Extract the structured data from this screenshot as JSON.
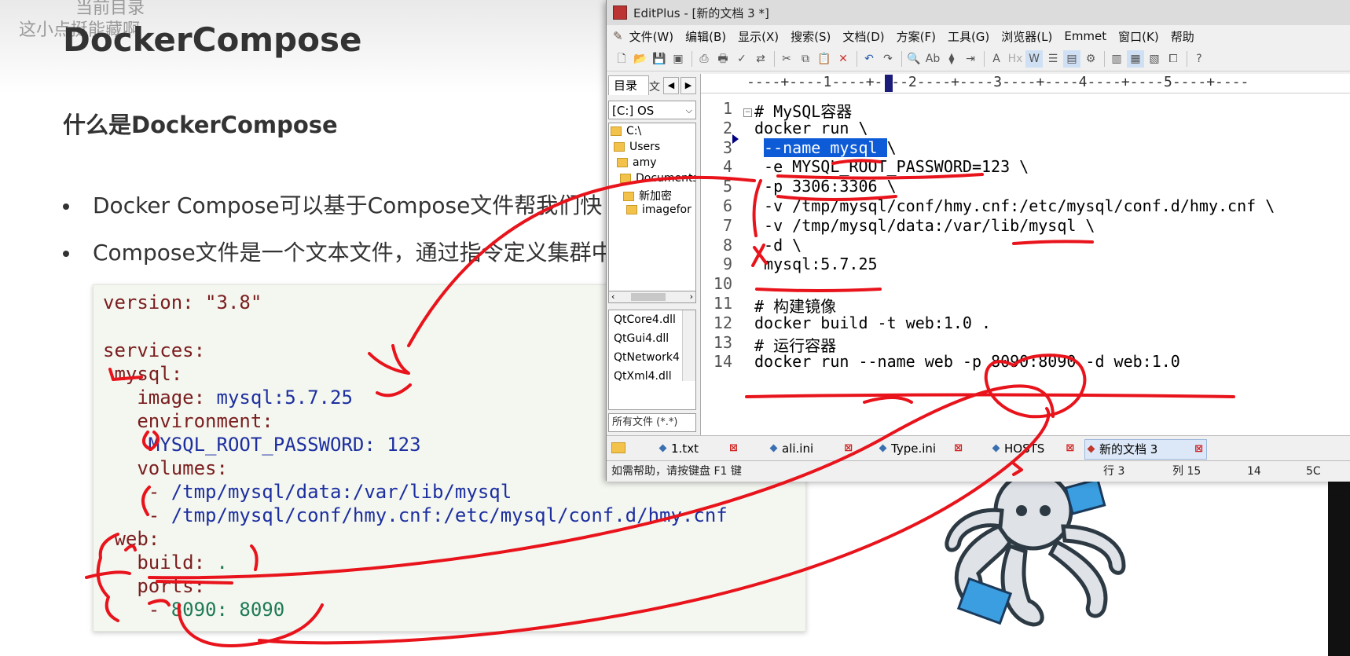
{
  "slide": {
    "overlay_top": "当前目录",
    "overlay_sub": "这小点挺能藏啊",
    "title": "DockerCompose",
    "subtitle": "什么是DockerCompose",
    "bullets": [
      "Docker Compose可以基于Compose文件帮我们快",
      "Compose文件是一个文本文件，通过指令定义集群中"
    ],
    "yaml": {
      "l1": "version: \"3.8\"",
      "l3": "services:",
      "l4": " mysql:",
      "l5_key": "   image: ",
      "l5_val": "mysql:5.7.25",
      "l6": "   environment:",
      "l7_key": "    MYSQL_ROOT_PASSWORD: ",
      "l7_val": "123",
      "l8": "   volumes:",
      "l9_dash": "    - ",
      "l9_val": "/tmp/mysql/data:/var/lib/mysql",
      "l10_dash": "    - ",
      "l10_val": "/tmp/mysql/conf/hmy.cnf:/etc/mysql/conf.d/hmy.cnf",
      "l11": " web:",
      "l12_key": "   build: ",
      "l12_val": ".",
      "l13": "   ports:",
      "l14_dash": "    - ",
      "l14_val": "8090: 8090"
    }
  },
  "window": {
    "title": "EditPlus - [新的文档 3 *]",
    "menu": [
      "文件(W)",
      "编辑(B)",
      "显示(X)",
      "搜索(S)",
      "文档(D)",
      "方案(F)",
      "工具(G)",
      "浏览器(L)",
      "Emmet",
      "窗口(K)",
      "帮助"
    ],
    "left_panel": {
      "tab_dir": "目录",
      "tab_other": "文",
      "drive": "[C:] OS",
      "tree": [
        "C:\\",
        "Users",
        "amy",
        "Documents",
        "新加密",
        "imagefor"
      ],
      "files": [
        "QtCore4.dll",
        "QtGui4.dll",
        "QtNetwork4",
        "QtXml4.dll"
      ],
      "filter": "所有文件 (*.*)"
    },
    "ruler": "----+----1----+----2----+----3----+----4----+----5----+----",
    "lines": [
      {
        "n": "1",
        "text": "# MySQL容器"
      },
      {
        "n": "2",
        "text": "docker run \\"
      },
      {
        "n": "3",
        "selected": "--name mysql ",
        "rest": "\\"
      },
      {
        "n": "4",
        "text": " -e MYSQL_ROOT_PASSWORD=123 \\"
      },
      {
        "n": "5",
        "text": " -p 3306:3306 \\"
      },
      {
        "n": "6",
        "text": " -v /tmp/mysql/conf/hmy.cnf:/etc/mysql/conf.d/hmy.cnf \\"
      },
      {
        "n": "7",
        "text": " -v /tmp/mysql/data:/var/lib/mysql \\"
      },
      {
        "n": "8",
        "text": " -d \\"
      },
      {
        "n": "9",
        "text": " mysql:5.7.25"
      },
      {
        "n": "10",
        "text": ""
      },
      {
        "n": "11",
        "text": "# 构建镜像"
      },
      {
        "n": "12",
        "text": "docker build -t web:1.0 ."
      },
      {
        "n": "13",
        "text": "# 运行容器"
      },
      {
        "n": "14",
        "text": "docker run --name web -p 8090:8090 -d web:1.0"
      }
    ],
    "tabs": [
      "1.txt",
      "ali.ini",
      "Type.ini",
      "HOSTS",
      "新的文档 3"
    ],
    "status": {
      "help": "如需帮助，请按键盘 F1 键",
      "row": "行 3",
      "col": "列 15",
      "count": "14",
      "code": "5C"
    }
  },
  "colors": {
    "selection": "#0d5bd6",
    "ink": "#e8131b",
    "yaml_key": "#7a1e1e",
    "yaml_value": "#1c2fa0",
    "yaml_number": "#1e7a55"
  }
}
